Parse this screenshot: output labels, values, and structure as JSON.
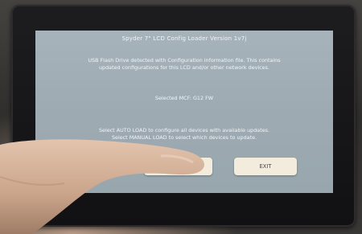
{
  "dialog": {
    "title": "Spyder 7\" LCD Config Loader Version 1v7j",
    "message": "USB Flash Drive detected with Configuration information file.  This contains updated configurations for this LCD and/or other network devices.",
    "selected_mcf": "Selected MCF: G12 FW",
    "instructions_line1": "Select AUTO LOAD to configure all devices with available updates.",
    "instructions_line2": "Select MANUAL LOAD to select which devices to update."
  },
  "buttons": {
    "auto_load_visible_label": "LOAD",
    "exit_label": "EXIT"
  },
  "colors": {
    "screen": "#a1adb5",
    "button": "#f3ecdd",
    "bezel": "#151517"
  }
}
